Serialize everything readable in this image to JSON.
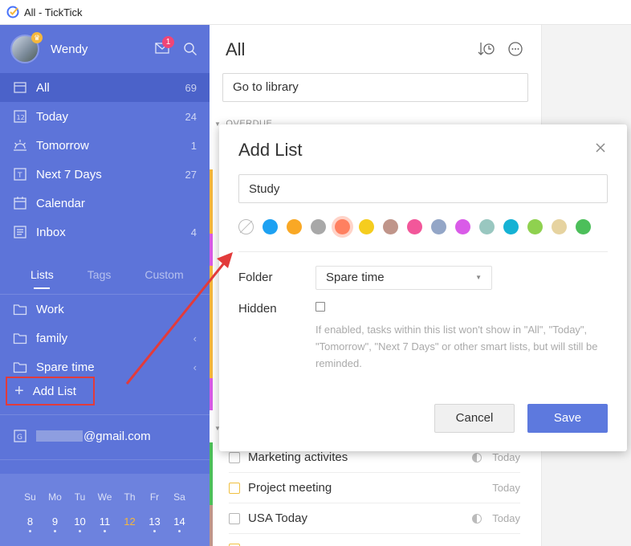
{
  "window": {
    "title": "All - TickTick"
  },
  "user": {
    "name": "Wendy",
    "notification_count": "1"
  },
  "smart_lists": [
    {
      "label": "All",
      "count": "69",
      "icon": "stack-icon"
    },
    {
      "label": "Today",
      "count": "24",
      "icon": "calendar-12-icon"
    },
    {
      "label": "Tomorrow",
      "count": "1",
      "icon": "sunrise-icon"
    },
    {
      "label": "Next 7 Days",
      "count": "27",
      "icon": "calendar-t-icon"
    },
    {
      "label": "Calendar",
      "count": "",
      "icon": "calendar-grid-icon"
    },
    {
      "label": "Inbox",
      "count": "4",
      "icon": "inbox-icon"
    }
  ],
  "sidebar_tabs": [
    "Lists",
    "Tags",
    "Custom"
  ],
  "lists": [
    {
      "label": "Work",
      "has_children": false
    },
    {
      "label": "family",
      "has_children": true
    },
    {
      "label": "Spare time",
      "has_children": true
    }
  ],
  "add_list_label": "Add List",
  "account": {
    "email_suffix": "@gmail.com"
  },
  "calendar": {
    "weekdays": [
      "Su",
      "Mo",
      "Tu",
      "We",
      "Th",
      "Fr",
      "Sa"
    ],
    "days": [
      "8",
      "9",
      "10",
      "11",
      "12",
      "13",
      "14"
    ],
    "today": "12"
  },
  "main": {
    "title": "All",
    "library_text": "Go to library",
    "overdue_label": "OVERDUE",
    "tasks": [
      {
        "title": "Marketing activites",
        "due": "Today",
        "checkbox": "gray",
        "progress": true
      },
      {
        "title": "Project meeting",
        "due": "Today",
        "checkbox": "yellow",
        "progress": false
      },
      {
        "title": "USA Today",
        "due": "Today",
        "checkbox": "gray",
        "progress": true
      }
    ]
  },
  "dialog": {
    "title": "Add List",
    "name_value": "Study",
    "colors": [
      "none",
      "#1da1f2",
      "#f9a825",
      "#a8a8a8",
      "#ff8060",
      "#f5cd1e",
      "#c0958a",
      "#f2579a",
      "#93a6c7",
      "#d95be8",
      "#99c7c0",
      "#15b2d4",
      "#8fd14f",
      "#e6d3a0",
      "#4cbf5a"
    ],
    "selected_color": "#ff8060",
    "folder_label": "Folder",
    "folder_value": "Spare time",
    "hidden_label": "Hidden",
    "hidden_checked": false,
    "hidden_hint": "If enabled, tasks within this list won't show in \"All\", \"Today\", \"Tomorrow\", \"Next 7 Days\" or other smart lists, but will still be reminded.",
    "cancel_label": "Cancel",
    "save_label": "Save"
  }
}
